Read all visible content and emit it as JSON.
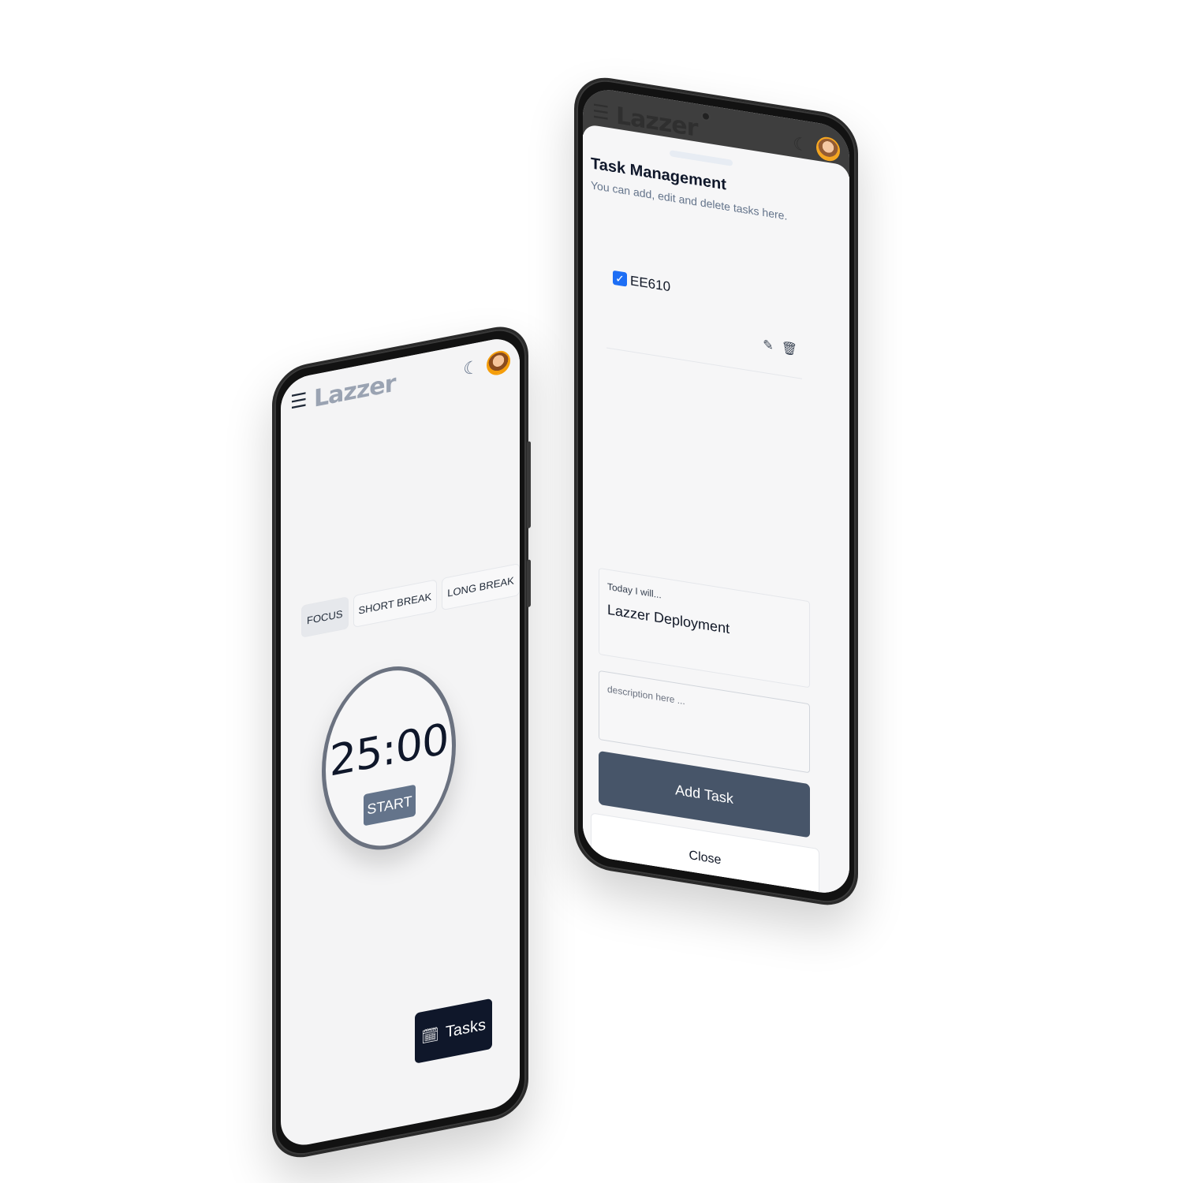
{
  "timer_app": {
    "header": {
      "logo": "Lazzer",
      "menu_icon": "☰",
      "theme_icon": "☾"
    },
    "modes": [
      {
        "label": "FOCUS",
        "active": true
      },
      {
        "label": "SHORT BREAK",
        "active": false
      },
      {
        "label": "LONG BREAK",
        "active": false
      }
    ],
    "timer": {
      "value": "25:00",
      "start_label": "START"
    },
    "tasks_button": {
      "label": "Tasks",
      "icon": "🗓"
    }
  },
  "task_app": {
    "header": {
      "logo": "Lazzer",
      "menu_icon": "☰",
      "theme_icon": "☾"
    },
    "title": "Task Management",
    "subtitle": "You can add, edit and delete tasks here.",
    "tasks": [
      {
        "name": "EE610",
        "checked": true,
        "check_icon": "✓",
        "edit_icon": "✎",
        "delete_icon": "🗑"
      }
    ],
    "form": {
      "title_label": "Today I will...",
      "title_value": "Lazzer Deployment",
      "description_placeholder": "description here ...",
      "add_label": "Add Task",
      "close_label": "Close"
    },
    "colors": {
      "primary": "#475569",
      "dark": "#0f172a",
      "accent_check": "#1d6ef5"
    }
  }
}
